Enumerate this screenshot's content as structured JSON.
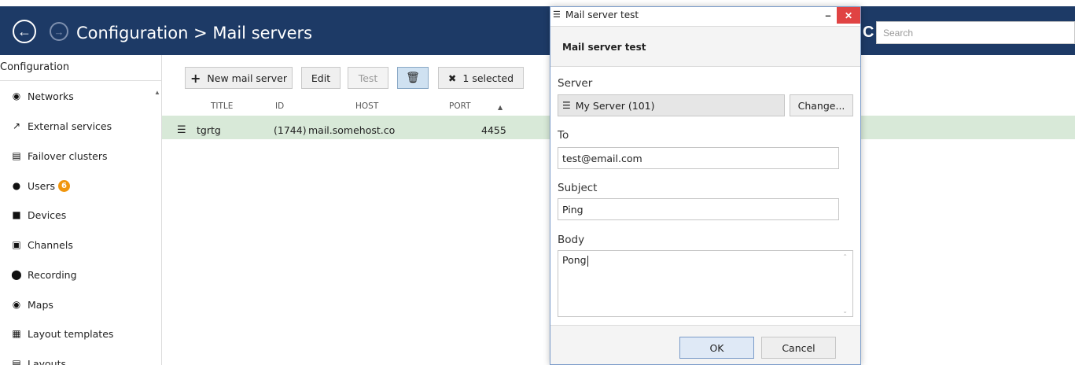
{
  "header": {
    "title": "Configuration > Mail servers",
    "app_mark": "C",
    "search_placeholder": "Search"
  },
  "sidebar": {
    "title": "Configuration",
    "items": [
      {
        "label": "Networks",
        "icon": "globe-icon"
      },
      {
        "label": "External services",
        "icon": "external-link-icon"
      },
      {
        "label": "Failover clusters",
        "icon": "server-stack-icon"
      },
      {
        "label": "Users",
        "icon": "user-icon",
        "badge": "6"
      },
      {
        "label": "Devices",
        "icon": "camera-icon"
      },
      {
        "label": "Channels",
        "icon": "channel-icon"
      },
      {
        "label": "Recording",
        "icon": "record-dot-icon"
      },
      {
        "label": "Maps",
        "icon": "map-icon"
      },
      {
        "label": "Layout templates",
        "icon": "layout-template-icon"
      },
      {
        "label": "Layouts",
        "icon": "layouts-icon"
      }
    ]
  },
  "toolbar": {
    "new_label": "New mail server",
    "edit_label": "Edit",
    "test_label": "Test",
    "selected_label": "1 selected"
  },
  "table": {
    "columns": [
      "TITLE",
      "ID",
      "HOST",
      "PORT"
    ],
    "rows": [
      {
        "title": "tgrtg",
        "id": "(1744)",
        "host": "mail.somehost.co",
        "port": "4455"
      }
    ]
  },
  "dialog": {
    "window_title": "Mail server test",
    "subtitle": "Mail server test",
    "server_label": "Server",
    "server_value": "My Server (101)",
    "change_label": "Change...",
    "to_label": "To",
    "to_value": "test@email.com",
    "subject_label": "Subject",
    "subject_value": "Ping",
    "body_label": "Body",
    "body_value": "Pong",
    "ok_label": "OK",
    "cancel_label": "Cancel"
  },
  "colors": {
    "header_bg": "#1d3a66",
    "selected_row": "#d8e9d8",
    "badge": "#f0960e",
    "close_button": "#e04343"
  }
}
